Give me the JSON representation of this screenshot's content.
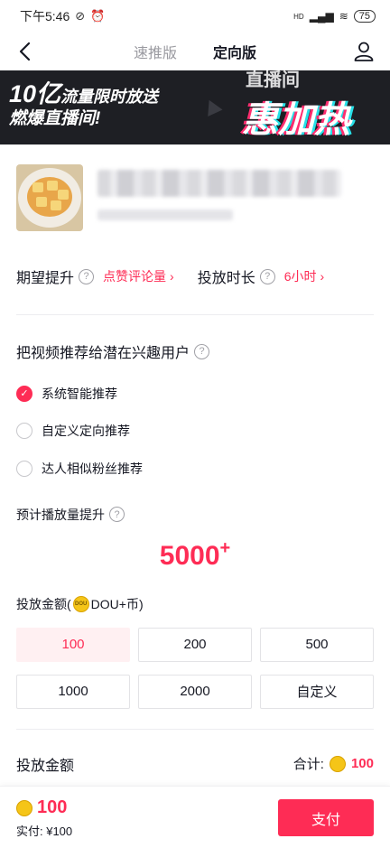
{
  "status_bar": {
    "time": "下午5:46",
    "battery": "75",
    "signal_label": "HD"
  },
  "nav": {
    "tabs": [
      {
        "label": "速推版",
        "active": false
      },
      {
        "label": "定向版",
        "active": true
      }
    ]
  },
  "banner": {
    "line1_big": "10亿",
    "line1_rest": "流量限时放送",
    "line2": "燃爆直播间!",
    "promo": "惠加热",
    "promo_top": "直播间"
  },
  "goal": {
    "label1": "期望提升",
    "value1": "点赞评论量",
    "label2": "投放时长",
    "value2": "6小时"
  },
  "targeting": {
    "title": "把视频推荐给潜在兴趣用户",
    "options": [
      {
        "label": "系统智能推荐",
        "selected": true
      },
      {
        "label": "自定义定向推荐",
        "selected": false
      },
      {
        "label": "达人相似粉丝推荐",
        "selected": false
      }
    ]
  },
  "forecast": {
    "label": "预计播放量提升",
    "value": "5000",
    "suffix": "+"
  },
  "amount": {
    "label_prefix": "投放金额(",
    "label_suffix": "DOU+币)",
    "coin_text": "DOU",
    "options": [
      "100",
      "200",
      "500",
      "1000",
      "2000",
      "自定义"
    ],
    "selected": "100"
  },
  "summary": {
    "label": "投放金额",
    "total_label": "合计:",
    "total_value": "100"
  },
  "footer": {
    "amount": "100",
    "real_pay": "实付: ¥100",
    "pay_button": "支付"
  },
  "colors": {
    "accent": "#fe2c55",
    "selected_bg": "#fff0f2",
    "coin": "#f5c518"
  }
}
